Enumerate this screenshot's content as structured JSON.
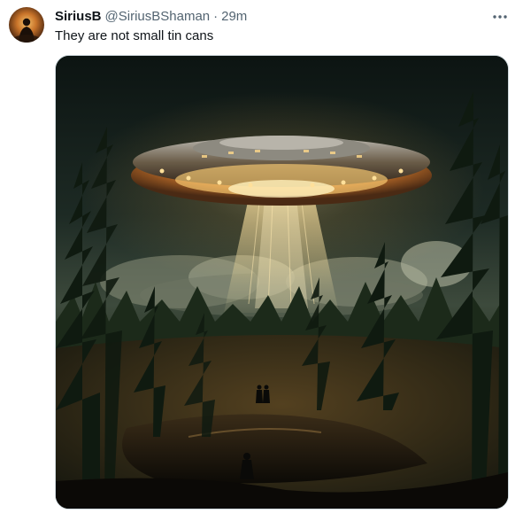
{
  "author": {
    "display_name": "SiriusB",
    "handle": "@SiriusBShaman",
    "separator": "·",
    "time": "29m"
  },
  "tweet": {
    "text": "They are not small tin cans",
    "more_icon": "more-horizontal-icon"
  },
  "media": {
    "alt": "UFO hovering over a dark pine forest with a glowing beam"
  },
  "colors": {
    "text_primary": "#0f1419",
    "text_secondary": "#536471",
    "border": "#cfd9de",
    "ufo_glow": "#f6b453"
  }
}
